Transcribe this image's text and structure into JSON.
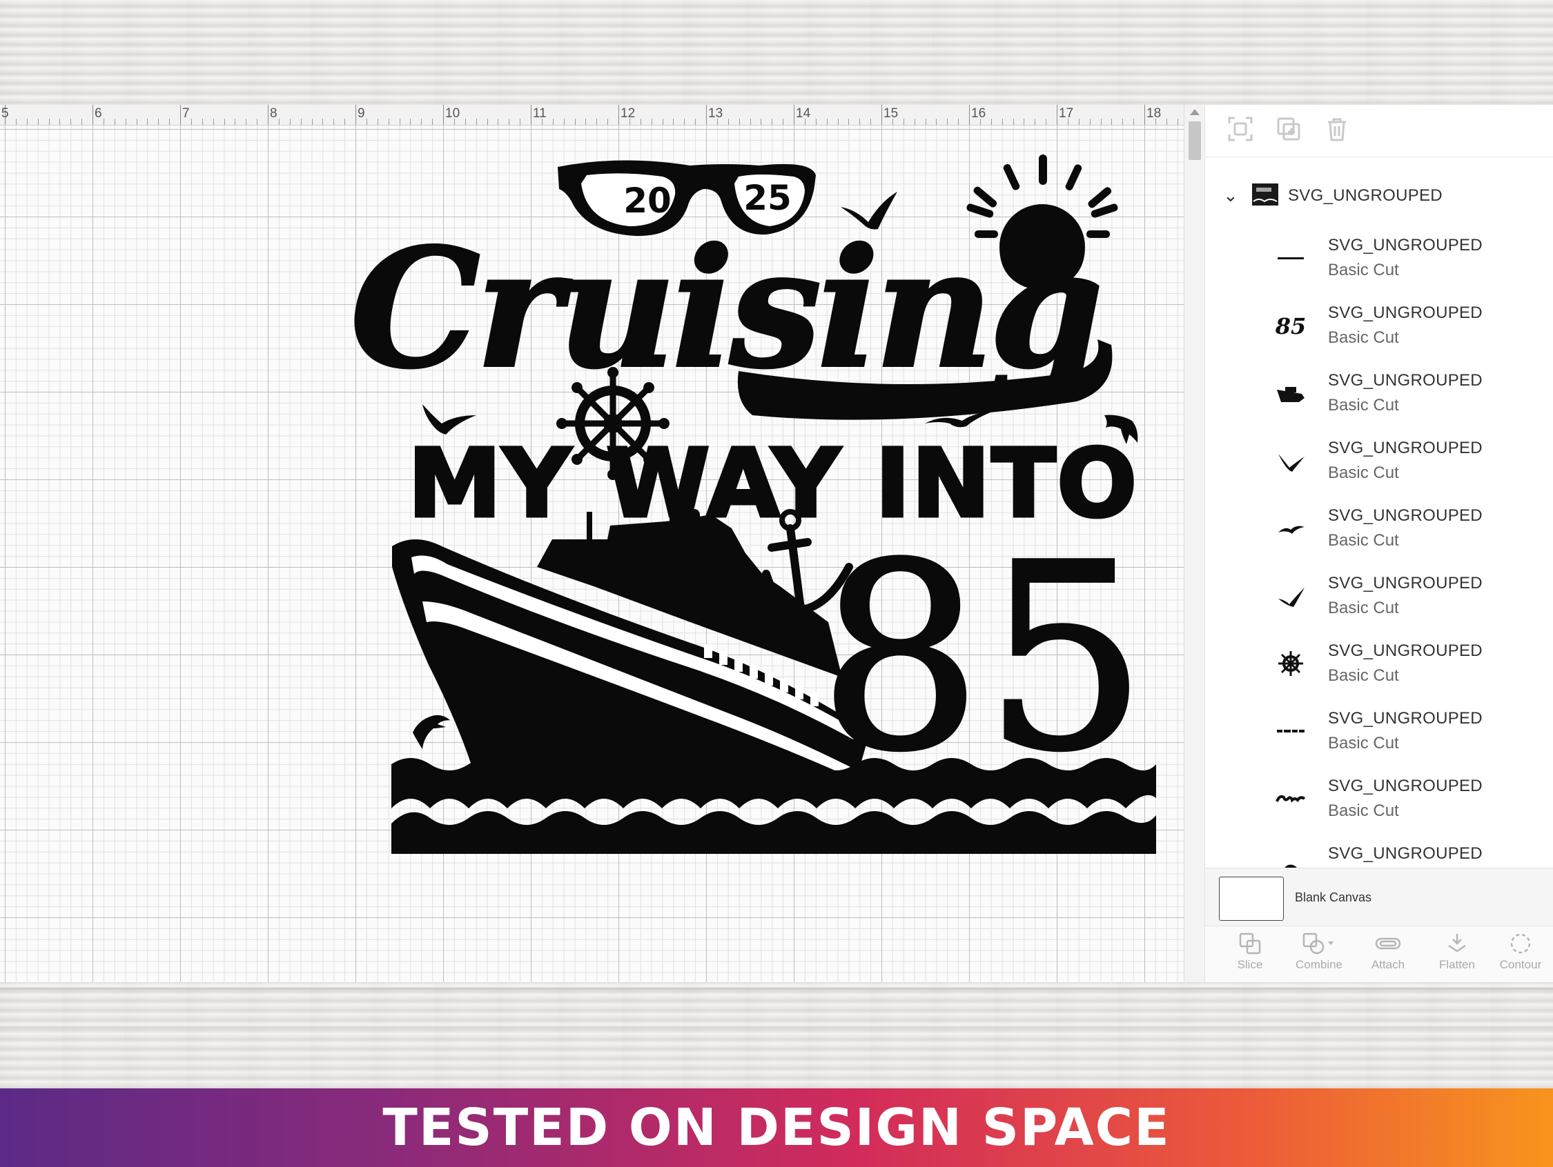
{
  "ruler": {
    "labels": [
      "5",
      "6",
      "7",
      "8",
      "9",
      "10",
      "11",
      "12",
      "13",
      "14",
      "15",
      "16",
      "17",
      "18"
    ]
  },
  "design": {
    "year_left": "20",
    "year_right": "25",
    "script_word": "Cruising",
    "line2": "MY WAY INTO",
    "age": "85"
  },
  "panel": {
    "group_name": "SVG_UNGROUPED",
    "layers": [
      {
        "name": "SVG_UNGROUPED",
        "type": "Basic Cut",
        "icon": "line-icon"
      },
      {
        "name": "SVG_UNGROUPED",
        "type": "Basic Cut",
        "icon": "number-85-icon"
      },
      {
        "name": "SVG_UNGROUPED",
        "type": "Basic Cut",
        "icon": "ship-icon"
      },
      {
        "name": "SVG_UNGROUPED",
        "type": "Basic Cut",
        "icon": "bird-icon"
      },
      {
        "name": "SVG_UNGROUPED",
        "type": "Basic Cut",
        "icon": "bird-small-icon"
      },
      {
        "name": "SVG_UNGROUPED",
        "type": "Basic Cut",
        "icon": "bird-icon"
      },
      {
        "name": "SVG_UNGROUPED",
        "type": "Basic Cut",
        "icon": "ship-wheel-icon"
      },
      {
        "name": "SVG_UNGROUPED",
        "type": "Basic Cut",
        "icon": "text-line-icon"
      },
      {
        "name": "SVG_UNGROUPED",
        "type": "Basic Cut",
        "icon": "cruising-script-icon"
      },
      {
        "name": "SVG_UNGROUPED",
        "type": "",
        "icon": "dolphin-icon"
      }
    ],
    "blank_canvas": "Blank Canvas",
    "tools": [
      {
        "label": "Slice",
        "icon": "slice-icon"
      },
      {
        "label": "Combine",
        "icon": "combine-icon"
      },
      {
        "label": "Attach",
        "icon": "attach-icon"
      },
      {
        "label": "Flatten",
        "icon": "flatten-icon"
      },
      {
        "label": "Contour",
        "icon": "contour-icon"
      }
    ]
  },
  "banner": {
    "text": "TESTED ON DESIGN SPACE"
  },
  "colors": {
    "ink": "#0a0a0a",
    "banner_start": "#5b2a86",
    "banner_end": "#f7941d"
  }
}
